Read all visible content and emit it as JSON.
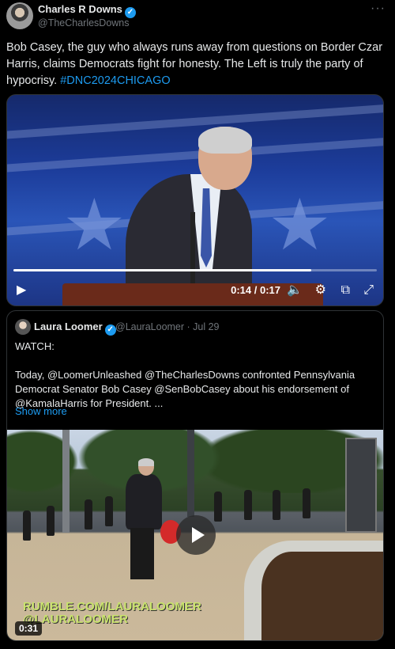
{
  "tweet": {
    "author_name": "Charles R Downs",
    "author_handle": "@TheCharlesDowns",
    "more_icon": "more-icon",
    "text_main": "Bob Casey, the guy who always runs away from questions on Border Czar Harris, claims Democrats fight for honesty. The Left is truly the party of hypocrisy. ",
    "hashtag": "#DNC2024CHICAGO"
  },
  "video": {
    "time_display": "0:14 / 0:17",
    "progress": 0.82,
    "controls": [
      "play-icon",
      "volume-icon",
      "settings-icon",
      "popout-icon",
      "fullscreen-icon"
    ]
  },
  "quoted_tweet": {
    "author_name": "Laura Loomer",
    "author_handle": "@LauraLoomer · Jul 29",
    "text": "WATCH:\n\nToday, @LoomerUnleashed @TheCharlesDowns confronted Pennsylvania Democrat Senator Bob Casey @SenBobCasey about his endorsement of @KamalaHarris for President. ...",
    "show_more": "Show more",
    "video_watermark": "RUMBLE.COM/LAURALOOMER\n@LAURALOOMER",
    "video_duration": "0:31"
  },
  "colors": {
    "accent": "#1d9bf0",
    "background": "#000000",
    "secondary_text": "#71767b"
  }
}
